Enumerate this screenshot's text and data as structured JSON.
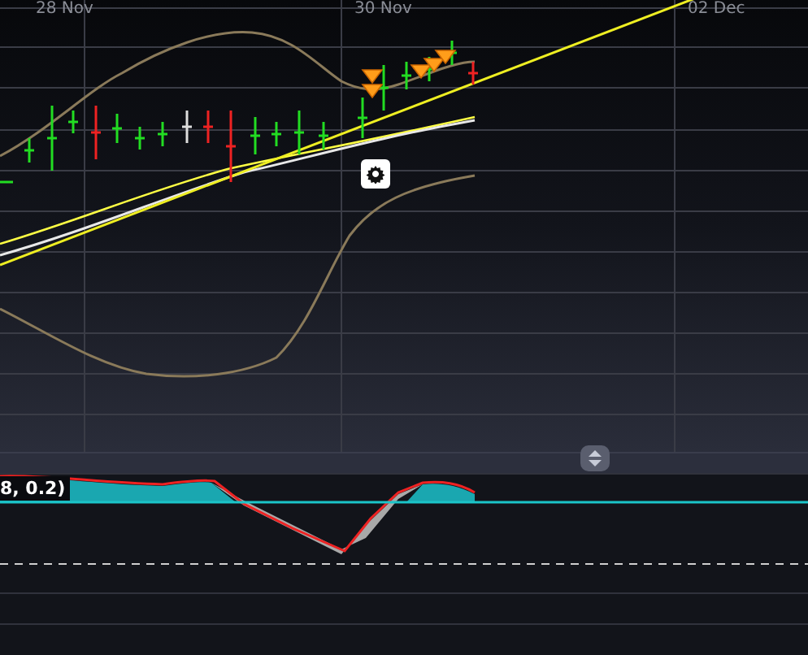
{
  "price_chart": {
    "date_labels": [
      {
        "text": "28 Nov"
      },
      {
        "text": "30 Nov"
      },
      {
        "text": "02 Dec"
      }
    ]
  },
  "indicator_panel": {
    "label": "8, 0.2)"
  }
}
